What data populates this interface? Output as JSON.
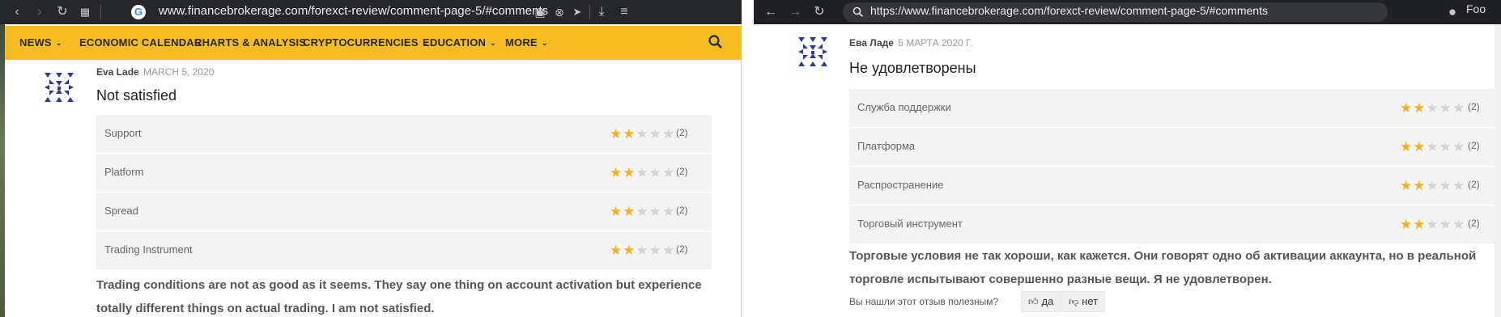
{
  "left_browser": {
    "url": "www.financebrokerage.com/forexct-review/comment-page-5/#comments",
    "nav": [
      {
        "label": "NEWS",
        "dropdown": true
      },
      {
        "label": "ECONOMIC CALENDAR",
        "dropdown": false
      },
      {
        "label": "CHARTS & ANALYSIS",
        "dropdown": false
      },
      {
        "label": "CRYPTOCURRENCIES",
        "dropdown": true
      },
      {
        "label": "EDUCATION",
        "dropdown": true
      },
      {
        "label": "MORE",
        "dropdown": true
      }
    ],
    "review": {
      "author": "Eva Lade",
      "date": "MARCH 5, 2020",
      "title": "Not satisfied",
      "ratings": [
        {
          "label": "Support",
          "stars": 2,
          "count": "(2)"
        },
        {
          "label": "Platform",
          "stars": 2,
          "count": "(2)"
        },
        {
          "label": "Spread",
          "stars": 2,
          "count": "(2)"
        },
        {
          "label": "Trading Instrument",
          "stars": 2,
          "count": "(2)"
        }
      ],
      "comment_line1": "Trading conditions are not as good as it seems. They say one thing on account activation but experience",
      "comment_line2": "totally different things on actual trading. I am not satisfied."
    }
  },
  "right_browser": {
    "url": "https://www.financebrokerage.com/forexct-review/comment-page-5/#comments",
    "profile_text": "Foo",
    "review": {
      "author": "Ева Ладе",
      "date": "5 МАРТА 2020 Г.",
      "title": "Не удовлетворены",
      "ratings": [
        {
          "label": "Служба поддержки",
          "stars": 2,
          "count": "(2)"
        },
        {
          "label": "Платформа",
          "stars": 2,
          "count": "(2)"
        },
        {
          "label": "Распространение",
          "stars": 2,
          "count": "(2)"
        },
        {
          "label": "Торговый инструмент",
          "stars": 2,
          "count": "(2)"
        }
      ],
      "comment_line1": "Торговые условия не так хороши, как кажется. Они говорят одно об активации аккаунта, но в реальной",
      "comment_line2": "торговле испытывают совершенно разные вещи. Я не удовлетворен.",
      "helpful_question": "Вы нашли этот отзыв полезным?",
      "yes_label": "да",
      "no_label": "нет"
    }
  },
  "colors": {
    "nav_bg": "#f7bc22",
    "star_on": "#f0b323",
    "star_off": "#d5d5d5"
  },
  "icons": [
    "back-icon",
    "forward-icon",
    "reload-icon",
    "tabs-grid-icon",
    "google-icon",
    "camera-icon",
    "close-circle-icon",
    "send-icon",
    "download-icon",
    "menu-icon",
    "search-icon",
    "chevron-down-icon",
    "star-icon",
    "thumbs-up-icon",
    "thumbs-down-icon",
    "profile-icon",
    "avatar-pattern-icon"
  ]
}
